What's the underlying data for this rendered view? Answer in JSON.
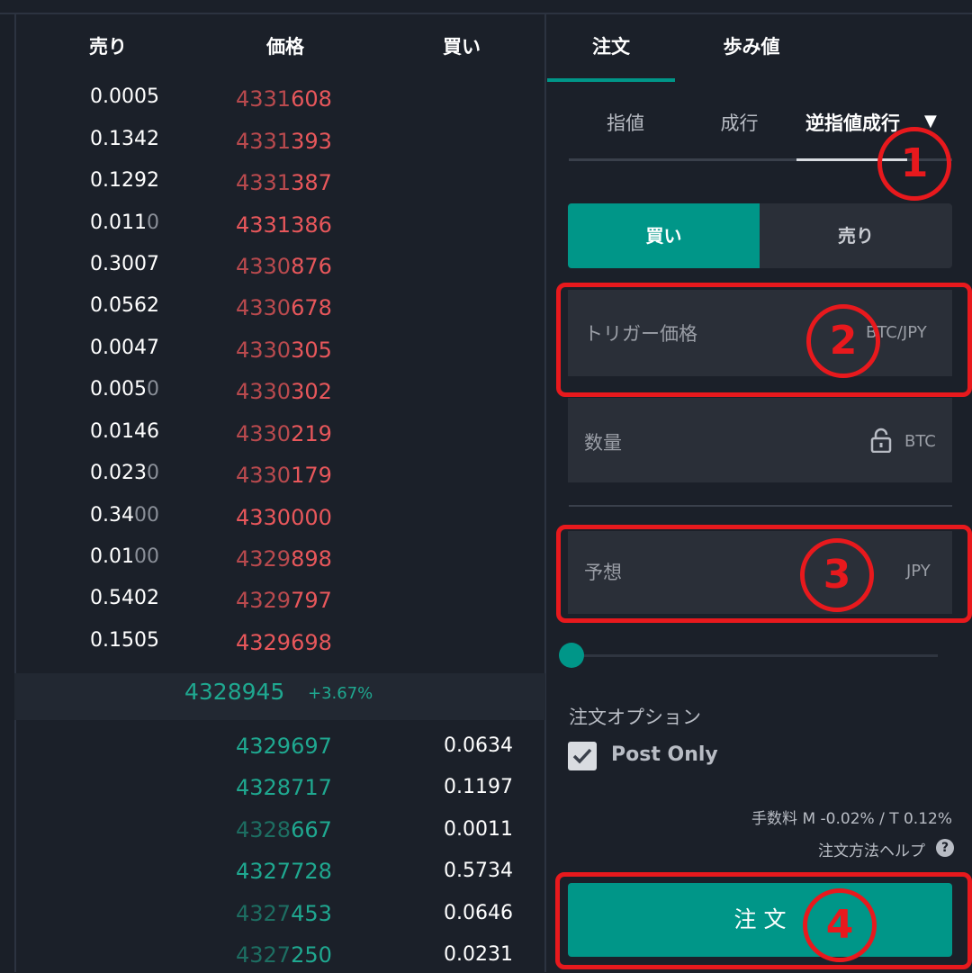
{
  "orderbook": {
    "headers": {
      "sell": "売り",
      "price": "価格",
      "buy": "買い"
    },
    "asks": [
      {
        "qty": "0.0005",
        "qty_dim": "",
        "price_a": "4331",
        "price_b": "608"
      },
      {
        "qty": "0.1342",
        "qty_dim": "",
        "price_a": "4331",
        "price_b": "393"
      },
      {
        "qty": "0.1292",
        "qty_dim": "",
        "price_a": "4331",
        "price_b": "387"
      },
      {
        "qty": "0.011",
        "qty_dim": "0",
        "price_a": "4331386",
        "price_b": ""
      },
      {
        "qty": "0.3007",
        "qty_dim": "",
        "price_a": "4330",
        "price_b": "876"
      },
      {
        "qty": "0.0562",
        "qty_dim": "",
        "price_a": "4330",
        "price_b": "678"
      },
      {
        "qty": "0.0047",
        "qty_dim": "",
        "price_a": "4330",
        "price_b": "305"
      },
      {
        "qty": "0.005",
        "qty_dim": "0",
        "price_a": "4330",
        "price_b": "302"
      },
      {
        "qty": "0.0146",
        "qty_dim": "",
        "price_a": "4330",
        "price_b": "219"
      },
      {
        "qty": "0.023",
        "qty_dim": "0",
        "price_a": "4330",
        "price_b": "179"
      },
      {
        "qty": "0.34",
        "qty_dim": "00",
        "price_a": "4330000",
        "price_b": ""
      },
      {
        "qty": "0.01",
        "qty_dim": "00",
        "price_a": "4329",
        "price_b": "898"
      },
      {
        "qty": "0.5402",
        "qty_dim": "",
        "price_a": "4329",
        "price_b": "797"
      },
      {
        "qty": "0.1505",
        "qty_dim": "",
        "price_a": "4329698",
        "price_b": ""
      }
    ],
    "last_price": "4328945",
    "change": "+3.67%",
    "bids": [
      {
        "price_a": "4329697",
        "price_b": "",
        "qty": "0.0634"
      },
      {
        "price_a": "4328717",
        "price_b": "",
        "qty": "0.1197"
      },
      {
        "price_a": "4328",
        "price_b": "667",
        "qty": "0.0011"
      },
      {
        "price_a": "4327728",
        "price_b": "",
        "qty": "0.5734"
      },
      {
        "price_a": "4327",
        "price_b": "453",
        "qty": "0.0646"
      },
      {
        "price_a": "4327",
        "price_b": "250",
        "qty": "0.0231"
      }
    ]
  },
  "panel": {
    "tabs": {
      "order": "注文",
      "trades": "歩み値"
    },
    "order_types": {
      "limit": "指値",
      "market": "成行",
      "stop": "逆指値成行"
    },
    "side": {
      "buy": "買い",
      "sell": "売り"
    },
    "trigger": {
      "label": "トリガー価格",
      "unit": "BTC/JPY"
    },
    "amount": {
      "label": "数量",
      "unit": "BTC"
    },
    "estimate": {
      "label": "予想",
      "unit": "JPY"
    },
    "options_label": "注文オプション",
    "post_only": "Post Only",
    "fee": "手数料 M -0.02% / T 0.12%",
    "help": "注文方法ヘルプ",
    "submit": "注 文",
    "badges": {
      "one": "1",
      "two": "2",
      "three": "3",
      "four": "4"
    }
  },
  "colors": {
    "accent": "#009688",
    "ask": "#e8575b",
    "bid": "#1fa890",
    "highlight": "#e8191d"
  }
}
